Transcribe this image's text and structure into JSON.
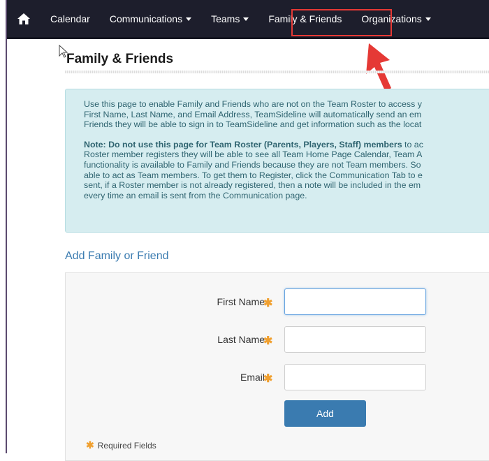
{
  "nav": {
    "items": [
      {
        "label": "Calendar",
        "dropdown": false
      },
      {
        "label": "Communications",
        "dropdown": true
      },
      {
        "label": "Teams",
        "dropdown": true
      },
      {
        "label": "Family & Friends",
        "dropdown": false,
        "active": true
      },
      {
        "label": "Organizations",
        "dropdown": true
      }
    ],
    "home_icon": "home-icon"
  },
  "page": {
    "title": "Family & Friends"
  },
  "info": {
    "lines1": [
      "Use this page to enable Family and Friends who are not on the Team Roster to access y",
      "First Name, Last Name, and Email Address, TeamSideline will automatically send an em",
      "Friends they will be able to sign in to TeamSideline and get information such as the locat"
    ],
    "note_bold": "Note: Do not use this page for Team Roster (Parents, Players, Staff) members",
    "note_bold_tail": " to ac",
    "lines2": [
      "Roster member registers they will be able to see all Team Home Page Calendar, Team A",
      "functionality is available to Family and Friends because they are not Team members. So",
      "able to act as Team members. To get them to Register, click the Communication Tab to e",
      "sent, if a Roster member is not already registered, then a note will be included in the em",
      "every time an email is sent from the Communication page."
    ]
  },
  "form": {
    "section_title": "Add Family or Friend",
    "first_name_label": "First Name",
    "last_name_label": "Last Name",
    "email_label": "Email",
    "required_marker": "✱",
    "add_button": "Add",
    "required_note": "Required Fields",
    "first_name_value": "",
    "last_name_value": "",
    "email_value": ""
  },
  "colors": {
    "navbar": "#1d1e2c",
    "highlight": "#e53935",
    "info_bg": "#d6edf0",
    "accent": "#3a7bb0",
    "required": "#f0a030"
  }
}
